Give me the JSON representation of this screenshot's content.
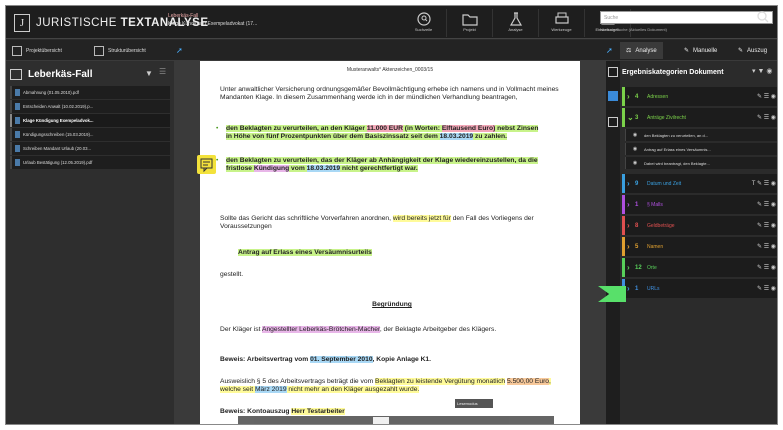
{
  "app": {
    "brand_prefix": "JURISTISCHE ",
    "brand_bold": "TEXTANALYSE",
    "logo_letter": "J"
  },
  "file": {
    "line1": "Leberkäs-Fall",
    "line2": "Klage Kündigung Exempeladvokat (17..."
  },
  "tools": [
    {
      "label": "Suchzeile",
      "icon": "search-circle-icon"
    },
    {
      "label": "Projekt",
      "icon": "folder-icon"
    },
    {
      "label": "Analyse",
      "icon": "flask-icon"
    },
    {
      "label": "Werkzeuge",
      "icon": "printer-icon"
    },
    {
      "label": "Einstellungen",
      "icon": "settings-box-icon"
    }
  ],
  "search": {
    "placeholder": "Suche",
    "sub": "Normale Suche (Aktuelles Dokument)"
  },
  "secbar": {
    "projekt": "Projektübersicht",
    "struktur": "Strukturübersicht",
    "analyse": "Analyse",
    "manuelle": "Manuelle",
    "auszug": "Auszug"
  },
  "case": {
    "title": "Leberkäs-Fall"
  },
  "files": [
    "Abmahnung (01.05.2010).pdf",
    "Entscheiden Anwalt (10.02.2019).p...",
    "Klage Kündigung Exempeladvok...",
    "Kündigungsschreiben (15.03.2019)...",
    "Schreiben Mandant Urlaub (20.03...",
    "Urlaub Bestätigung (12.05.2019).pdf"
  ],
  "doc": {
    "header": "Musteranwalts° Aktenzeichen_0003/15",
    "intro": "Unter anwaltlicher Versicherung ordnungsgemäßer Bevollmächtigung erhebe ich namens und in Vollmacht meines Mandanten Klage. In diesem Zusammenhang werde ich in der mündlichen Verhandlung beantragen,",
    "b1_a": "den Beklagten zu verurteilen, an den Kläger ",
    "b1_b": "11.000 EUR",
    "b1_c": " (in Worten: ",
    "b1_d": "Elftausend Euro)",
    "b1_e": " nebst Zinsen in Höhe von fünf Prozentpunkten über dem Basiszinssatz seit dem ",
    "b1_f": "18.03.2019",
    "b1_g": " zu zahlen.",
    "b2_a": "den Beklagten zu verurteilen, das der Kläger ab Anhängigkeit der Klage wiedereinzustellen, da die fristlose ",
    "b2_b": "Kündigung",
    "b2_c": " vom ",
    "b2_d": "18.03.2019",
    "b2_e": " nicht gerechtfertigt war.",
    "p2_a": "Sollte das Gericht das schriftliche Vorverfahren anordnen, ",
    "p2_b": "wird bereits jetzt für",
    "p2_c": " den Fall des Vorliegens der Voraussetzungen",
    "antrag": "Antrag auf Erlass eines Versäumnisurteils",
    "gestellt": "gestellt.",
    "begruendung": "Begründung",
    "p3_a": "Der Kläger ist ",
    "p3_b": "Angestellter Leberkäs-Brötchen-Macher",
    "p3_c": ", der Beklagte Arbeitgeber des Klägers.",
    "beweis1_a": "Beweis: Arbeitsvertrag vom ",
    "beweis1_b": "01. September 2010",
    "beweis1_c": ", Kopie Anlage K1.",
    "p4_a": "Ausweislich § 5 des Arbeitsvertrags beträgt die vom ",
    "p4_b": "Beklagten zu leistende Vergütung monatlich",
    "p4_c": " ",
    "p4_d": "5.500,00 Euro",
    "p4_e": ", welche seit ",
    "p4_f": "März 2019",
    "p4_g": " nicht mehr an den Kläger ausgezahlt wurde.",
    "beweis2_a": "Beweis: Kontoauszug ",
    "beweis2_b": "Herr Testarbeiter"
  },
  "tooltip": "Lesemodus",
  "right": {
    "title": "Ergebniskategorien Dokument",
    "categories": [
      {
        "num": "4",
        "label": "Adressen",
        "color": "#7bd24a"
      },
      {
        "num": "3",
        "label": "Anträge Zivilrecht",
        "color": "#7bd24a"
      },
      {
        "num": "9",
        "label": "Datum und Zeit",
        "color": "#3aa0e0"
      },
      {
        "num": "1",
        "label": "§ Malls",
        "color": "#b050e0"
      },
      {
        "num": "8",
        "label": "Geldbeträge",
        "color": "#e05050"
      },
      {
        "num": "5",
        "label": "Namen",
        "color": "#e0a030"
      },
      {
        "num": "12",
        "label": "Orte",
        "color": "#58d05a"
      },
      {
        "num": "1",
        "label": "URLs",
        "color": "#4090e0"
      }
    ],
    "subitems": [
      "den Beklagten zu verurteilen, an d...",
      "Antrag auf Erlass eines Versäumnis...",
      "Dabei wird beantragt, den Beklagte..."
    ]
  }
}
